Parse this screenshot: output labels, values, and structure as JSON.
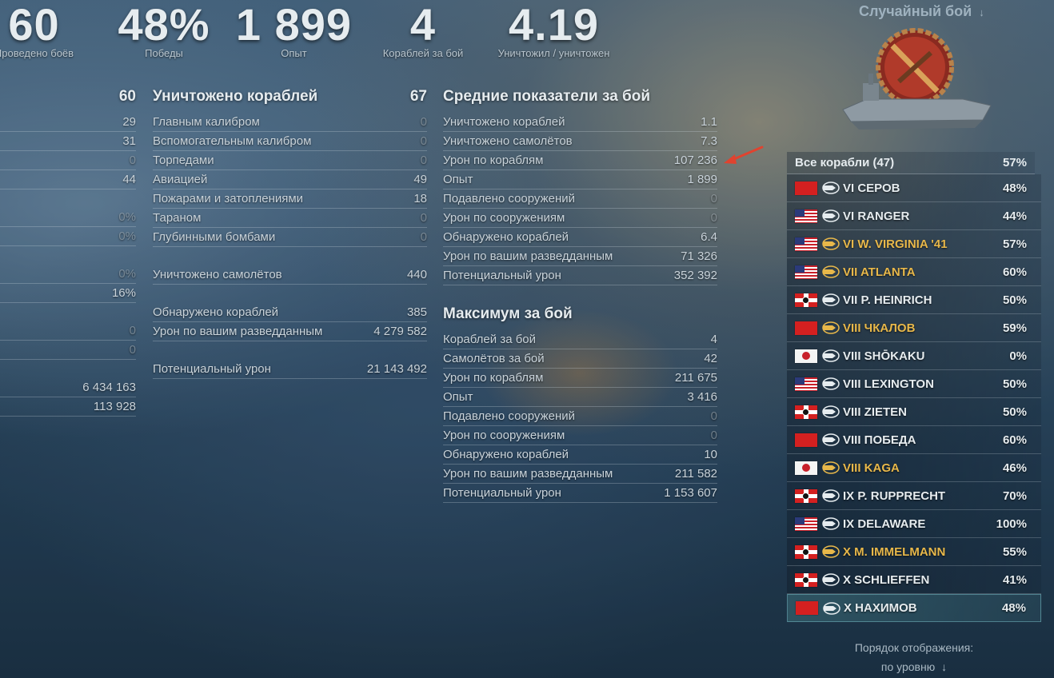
{
  "summary": [
    {
      "value": "60",
      "label": "Проведено боёв"
    },
    {
      "value": "48%",
      "label": "Победы"
    },
    {
      "value": "1 899",
      "label": "Опыт"
    },
    {
      "value": "4",
      "label": "Кораблей за бой"
    },
    {
      "value": "4.19",
      "label": "Уничтожил / уничтожен"
    }
  ],
  "left_col": {
    "head_value": "60",
    "rows": [
      "29",
      "31",
      "0",
      "44",
      "",
      "0%",
      "0%",
      "",
      "0%",
      "16%",
      "",
      "0",
      "0",
      "",
      "6 434 163",
      "113 928"
    ]
  },
  "destroyed": {
    "title": "Уничтожено кораблей",
    "total": "67",
    "rows": [
      {
        "label": "Главным калибром",
        "value": "0"
      },
      {
        "label": "Вспомогательным калибром",
        "value": "0"
      },
      {
        "label": "Торпедами",
        "value": "0"
      },
      {
        "label": "Авиацией",
        "value": "49"
      },
      {
        "label": "Пожарами и затоплениями",
        "value": "18"
      },
      {
        "label": "Тараном",
        "value": "0"
      },
      {
        "label": "Глубинными бомбами",
        "value": "0"
      }
    ],
    "planes": {
      "label": "Уничтожено самолётов",
      "value": "440"
    },
    "spotted": {
      "label": "Обнаружено кораблей",
      "value": "385"
    },
    "scout_dmg": {
      "label": "Урон по вашим разведданным",
      "value": "4 279 582"
    },
    "potential": {
      "label": "Потенциальный урон",
      "value": "21 143 492"
    }
  },
  "averages": {
    "title": "Средние показатели за бой",
    "rows": [
      {
        "label": "Уничтожено кораблей",
        "value": "1.1"
      },
      {
        "label": "Уничтожено самолётов",
        "value": "7.3"
      },
      {
        "label": "Урон по кораблям",
        "value": "107 236"
      },
      {
        "label": "Опыт",
        "value": "1 899"
      },
      {
        "label": "Подавлено сооружений",
        "value": "0"
      },
      {
        "label": "Урон по сооружениям",
        "value": "0"
      },
      {
        "label": "Обнаружено кораблей",
        "value": "6.4"
      },
      {
        "label": "Урон по вашим разведданным",
        "value": "71 326"
      },
      {
        "label": "Потенциальный урон",
        "value": "352 392"
      }
    ]
  },
  "maximum": {
    "title": "Максимум за бой",
    "rows": [
      {
        "label": "Кораблей за бой",
        "value": "4"
      },
      {
        "label": "Самолётов за бой",
        "value": "42"
      },
      {
        "label": "Урон по кораблям",
        "value": "211 675"
      },
      {
        "label": "Опыт",
        "value": "3 416"
      },
      {
        "label": "Подавлено сооружений",
        "value": "0"
      },
      {
        "label": "Урон по сооружениям",
        "value": "0"
      },
      {
        "label": "Обнаружено кораблей",
        "value": "10"
      },
      {
        "label": "Урон по вашим разведданным",
        "value": "211 582"
      },
      {
        "label": "Потенциальный урон",
        "value": "1 153 607"
      }
    ]
  },
  "right_panel": {
    "mode": "Случайный бой",
    "all_ships": {
      "label": "Все корабли (47)",
      "value": "57%"
    },
    "ships": [
      {
        "flag": "ussr",
        "name": "VI СЕРОВ",
        "wr": "48%",
        "premium": false
      },
      {
        "flag": "usa",
        "name": "VI RANGER",
        "wr": "44%",
        "premium": false
      },
      {
        "flag": "usa",
        "name": "VI W. VIRGINIA '41",
        "wr": "57%",
        "premium": true
      },
      {
        "flag": "usa",
        "name": "VII ATLANTA",
        "wr": "60%",
        "premium": true
      },
      {
        "flag": "de",
        "name": "VII P. HEINRICH",
        "wr": "50%",
        "premium": false
      },
      {
        "flag": "ussr",
        "name": "VIII ЧКАЛОВ",
        "wr": "59%",
        "premium": true
      },
      {
        "flag": "jp",
        "name": "VIII SHŌKAKU",
        "wr": "0%",
        "premium": false
      },
      {
        "flag": "usa",
        "name": "VIII LEXINGTON",
        "wr": "50%",
        "premium": false
      },
      {
        "flag": "de",
        "name": "VIII ZIETEN",
        "wr": "50%",
        "premium": false
      },
      {
        "flag": "ussr",
        "name": "VIII ПОБЕДА",
        "wr": "60%",
        "premium": false
      },
      {
        "flag": "jp",
        "name": "VIII KAGA",
        "wr": "46%",
        "premium": true
      },
      {
        "flag": "de",
        "name": "IX P. RUPPRECHT",
        "wr": "70%",
        "premium": false
      },
      {
        "flag": "usa",
        "name": "IX DELAWARE",
        "wr": "100%",
        "premium": false
      },
      {
        "flag": "de",
        "name": "X M. IMMELMANN",
        "wr": "55%",
        "premium": true
      },
      {
        "flag": "de",
        "name": "X SCHLIEFFEN",
        "wr": "41%",
        "premium": false
      },
      {
        "flag": "ussr",
        "name": "X НАХИМОВ",
        "wr": "48%",
        "premium": false
      }
    ],
    "order_label": "Порядок отображения:",
    "order_value": "по уровню"
  },
  "colors": {
    "accent_gold": "#e8b84a",
    "arrow": "#e0432f"
  }
}
